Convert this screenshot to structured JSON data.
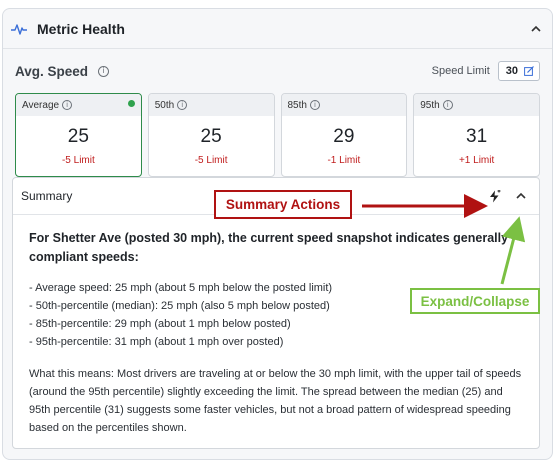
{
  "panel": {
    "title": "Metric Health"
  },
  "section": {
    "title": "Avg. Speed",
    "speed_limit_label": "Speed Limit",
    "speed_limit_value": "30"
  },
  "cards": [
    {
      "label": "Average",
      "value": "25",
      "limit": "-5 Limit",
      "active": true
    },
    {
      "label": "50th",
      "value": "25",
      "limit": "-5 Limit",
      "active": false
    },
    {
      "label": "85th",
      "value": "29",
      "limit": "-1 Limit",
      "active": false
    },
    {
      "label": "95th",
      "value": "31",
      "limit": "+1 Limit",
      "active": false
    }
  ],
  "summary": {
    "title": "Summary",
    "lead": "For Shetter Ave (posted 30 mph), the current speed snapshot indicates generally compliant speeds:",
    "bullets": [
      "- Average speed: 25 mph (about 5 mph below the posted limit)",
      "- 50th-percentile (median): 25 mph (also 5 mph below posted)",
      "- 85th-percentile: 29 mph (about 1 mph below posted)",
      "- 95th-percentile: 31 mph (about 1 mph over posted)"
    ],
    "paragraph": "What this means: Most drivers are traveling at or below the 30 mph limit, with the upper tail of speeds (around the 95th percentile) slightly exceeding the limit. The spread between the median (25) and 95th percentile (31) suggests some faster vehicles, but not a broad pattern of widespread speeding based on the percentiles shown."
  },
  "annotations": {
    "summary_actions": "Summary Actions",
    "expand_collapse": "Expand/Collapse",
    "red": "#b01212",
    "green": "#7bc043"
  },
  "colors": {
    "accent_green": "#2e8b4a",
    "limit_red": "#c01c1c",
    "pulse_blue": "#3b6fd8"
  }
}
